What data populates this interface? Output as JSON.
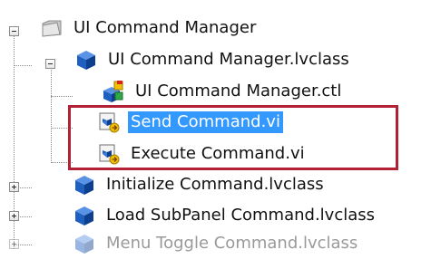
{
  "tree": {
    "root": {
      "label": "UI Command Manager",
      "icon": "folder-icon",
      "expanded": true
    },
    "class": {
      "label": "UI Command Manager.lvclass",
      "icon": "lvclass-cube-icon",
      "expanded": true
    },
    "children": [
      {
        "label": "UI Command Manager.ctl",
        "icon": "control-ctl-icon",
        "selected": false
      },
      {
        "label": "Send Command.vi",
        "icon": "vi-file-icon",
        "selected": true
      },
      {
        "label": "Execute Command.vi",
        "icon": "vi-file-icon",
        "selected": false
      }
    ],
    "siblings": [
      {
        "label": "Initialize Command.lvclass",
        "icon": "lvclass-cube-icon",
        "expanded": false
      },
      {
        "label": "Load SubPanel Command.lvclass",
        "icon": "lvclass-cube-icon",
        "expanded": false
      },
      {
        "label": "Menu Toggle Command.lvclass",
        "icon": "lvclass-cube-icon",
        "expanded": false,
        "faded": true
      }
    ]
  },
  "colors": {
    "selection": "#3399ff",
    "highlight_border": "#b32134",
    "class_cube": "#1f5fbf"
  }
}
